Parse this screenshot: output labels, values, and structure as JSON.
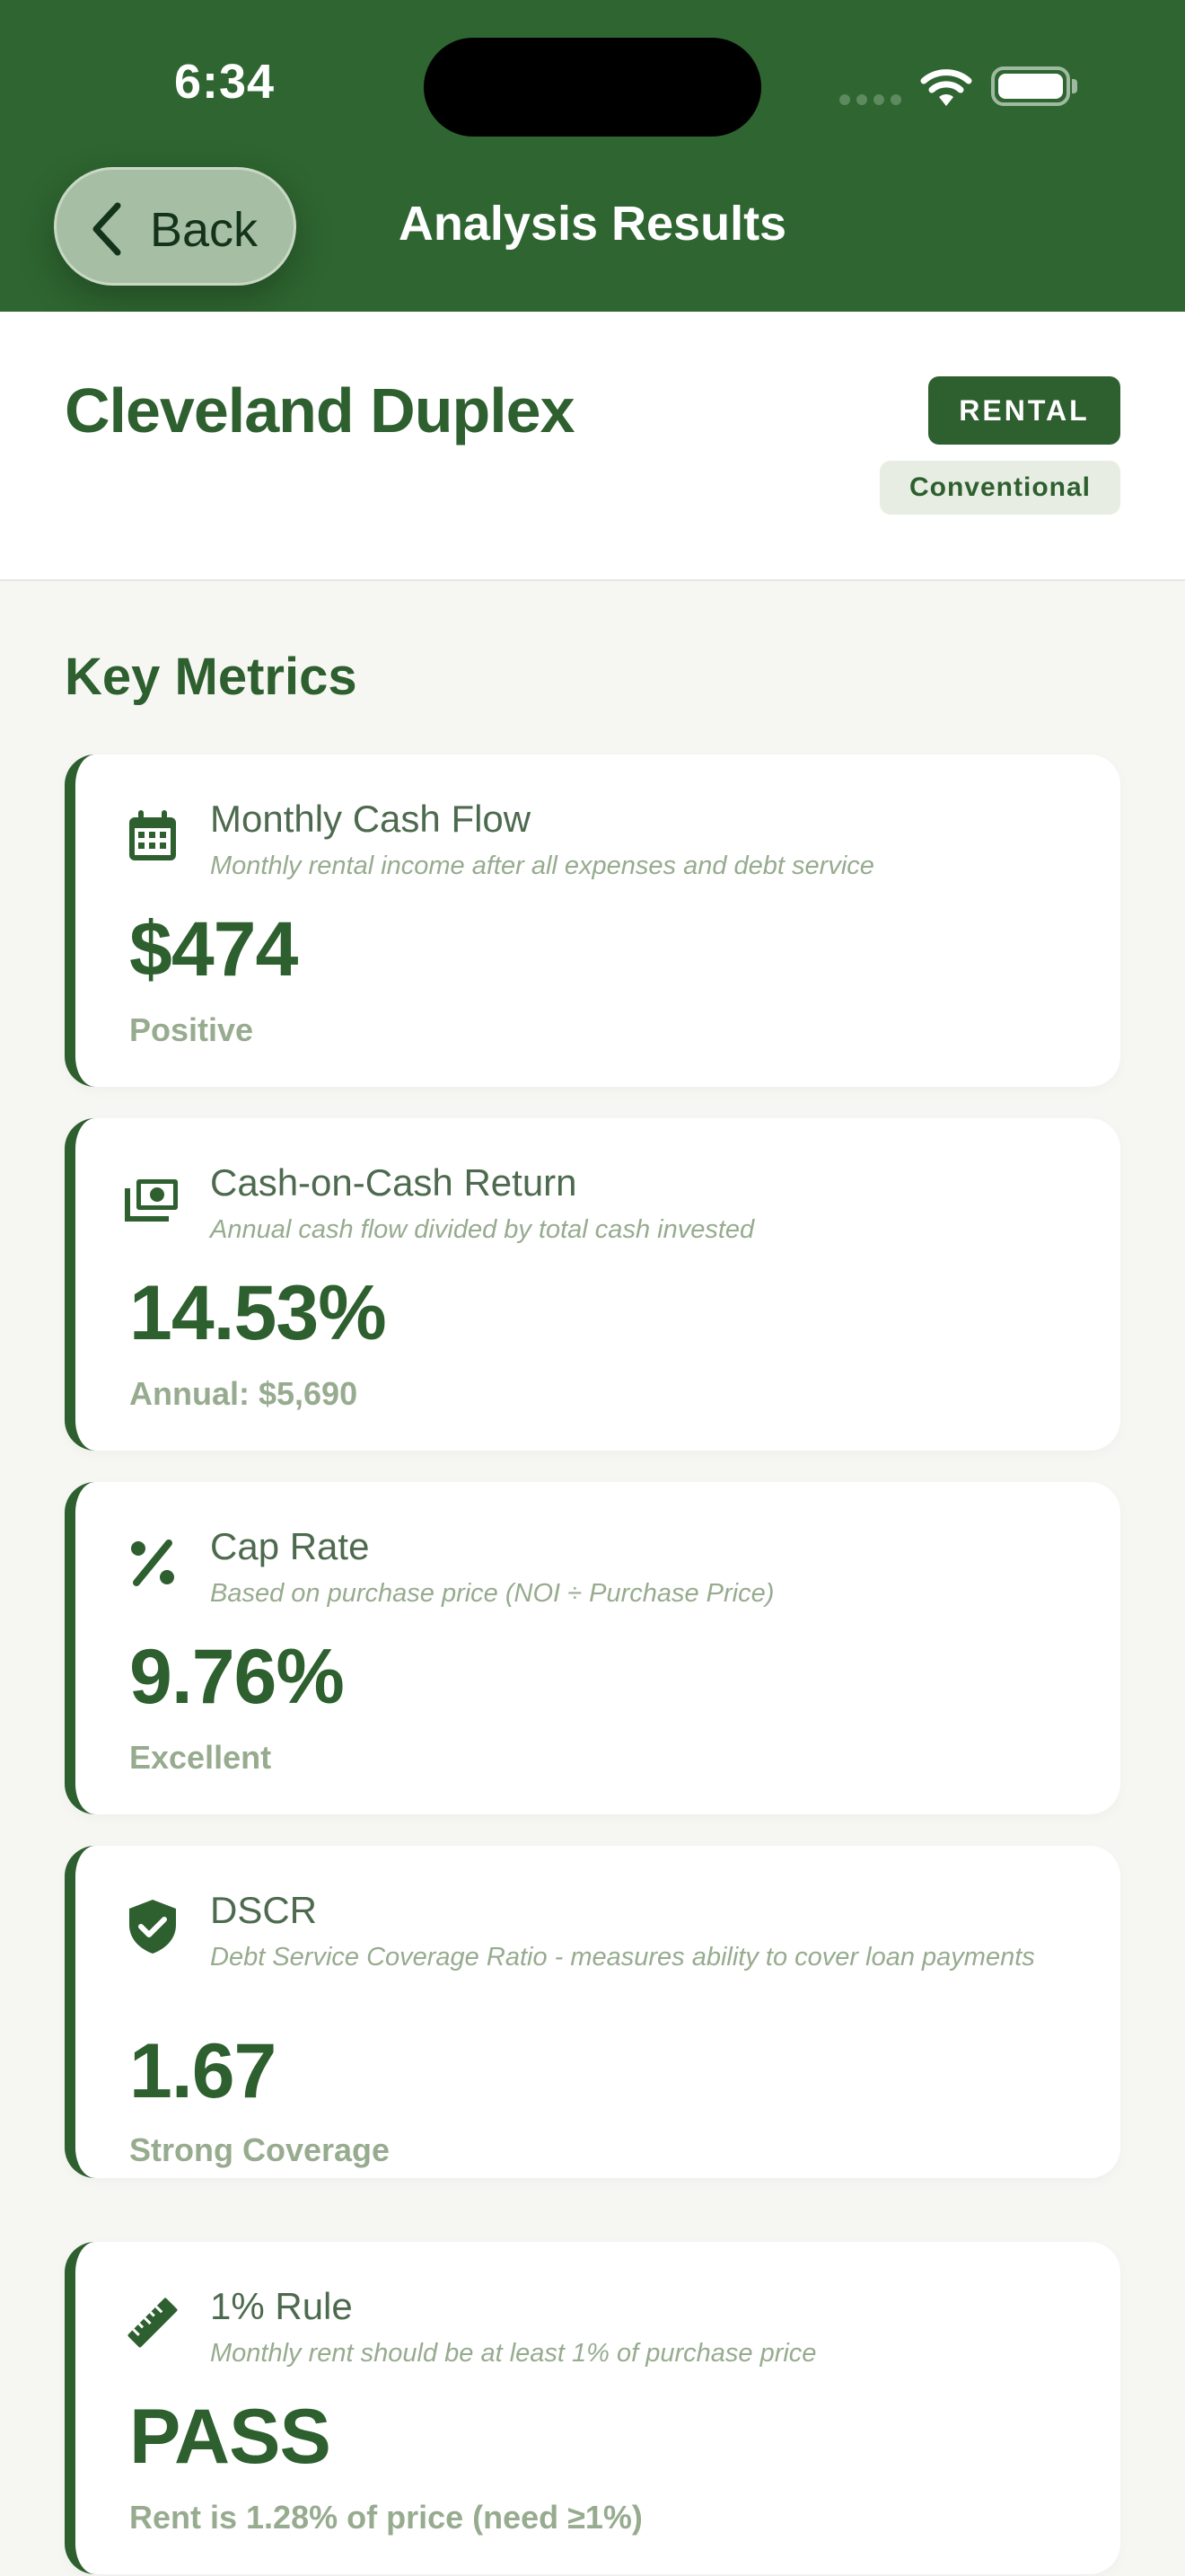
{
  "status_bar": {
    "time": "6:34"
  },
  "nav": {
    "back_label": "Back",
    "title": "Analysis Results"
  },
  "property": {
    "name": "Cleveland Duplex",
    "type_badge": "RENTAL",
    "financing_badge": "Conventional"
  },
  "section_title": "Key Metrics",
  "metrics": [
    {
      "icon": "calendar-icon",
      "label": "Monthly Cash Flow",
      "description": "Monthly rental income after all expenses and debt service",
      "value": "$474",
      "subtext": "Positive"
    },
    {
      "icon": "cash-icon",
      "label": "Cash-on-Cash Return",
      "description": "Annual cash flow divided by total cash invested",
      "value": "14.53%",
      "subtext": "Annual: $5,690"
    },
    {
      "icon": "percent-icon",
      "label": "Cap Rate",
      "description": "Based on purchase price (NOI ÷ Purchase Price)",
      "value": "9.76%",
      "subtext": "Excellent"
    },
    {
      "icon": "shield-check-icon",
      "label": "DSCR",
      "description": "Debt Service Coverage Ratio - measures ability to cover loan payments",
      "value": "1.67",
      "subtext": "Strong Coverage"
    },
    {
      "icon": "ruler-icon",
      "label": "1% Rule",
      "description": "Monthly rent should be at least 1% of purchase price",
      "value": "PASS",
      "subtext": "Rent is 1.28% of price (need ≥1%)"
    }
  ],
  "colors": {
    "header_bg": "#2e6530",
    "accent": "#2e5f2f",
    "muted_text": "#97ab8f",
    "page_bg": "#f6f7f3"
  }
}
